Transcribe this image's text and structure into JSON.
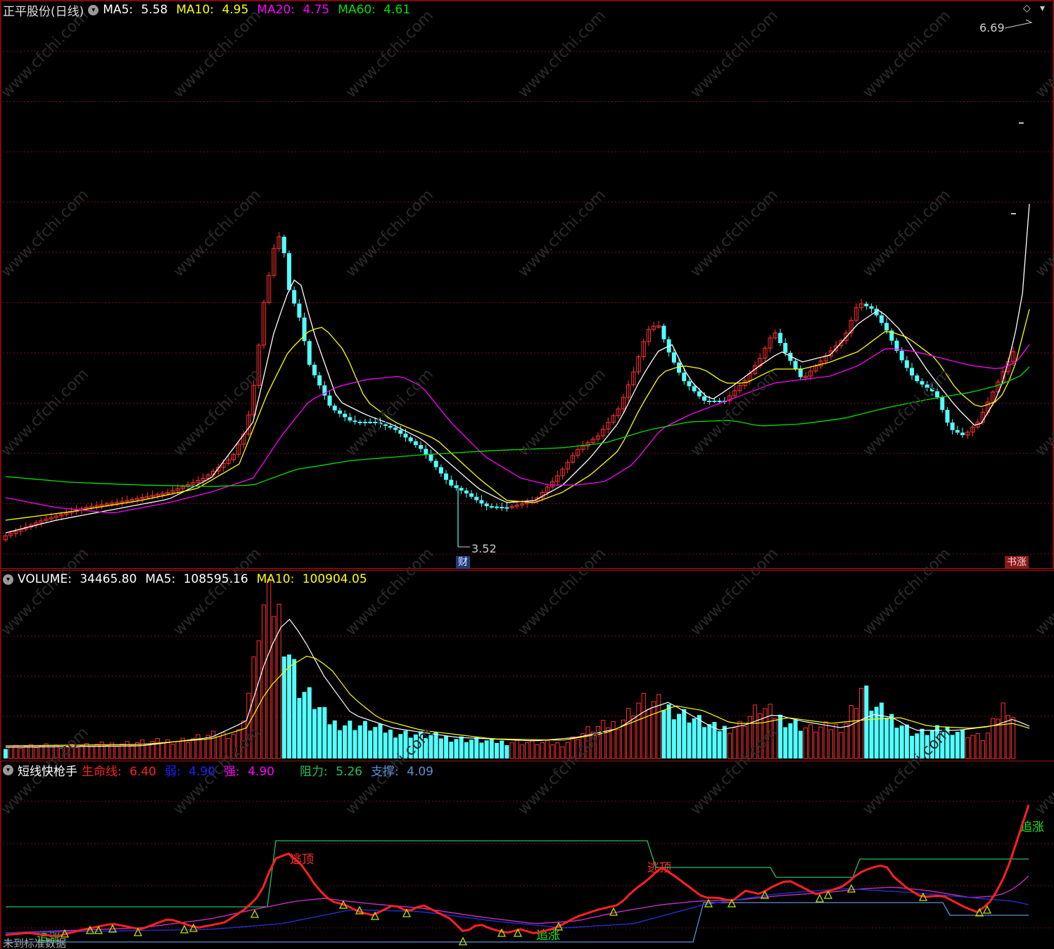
{
  "main": {
    "stock_title": "正平股份(日线)",
    "ma5_label": "MA5:",
    "ma5_value": "5.58",
    "ma10_label": "MA10:",
    "ma10_value": "4.95",
    "ma20_label": "MA20:",
    "ma20_value": "4.75",
    "ma60_label": "MA60:",
    "ma60_value": "4.61",
    "high_marker": "6.69",
    "low_marker": "3.52",
    "finance_badge": "财",
    "event_badge": "书涨",
    "corner_icon": "◇"
  },
  "volume": {
    "label": "VOLUME:",
    "value": "34465.80",
    "ma5_label": "MA5:",
    "ma5_value": "108595.16",
    "ma10_label": "MA10:",
    "ma10_value": "100904.05"
  },
  "indicator": {
    "name": "短线快枪手",
    "lifeline_label": "生命线:",
    "lifeline_value": "6.40",
    "weak_label": "弱:",
    "weak_value": "4.90",
    "strong_label": "强:",
    "strong_value": "4.90",
    "resist_label": "阻力:",
    "resist_value": "5.26",
    "support_label": "支撑:",
    "support_value": "4.09",
    "annotations": [
      "逃顶",
      "逃顶",
      "追涨",
      "追涨",
      "追涨"
    ],
    "footer_text": "未到标准数据"
  },
  "watermark": "www.cfchi.com",
  "colors": {
    "up": "#ff3232",
    "down": "#54ffff",
    "ma5": "#ffffff",
    "ma10": "#ffff00",
    "ma20": "#ff00ff",
    "ma60": "#00e000",
    "grid": "#7a1010",
    "lifeline": "#ff2020",
    "resist": "#20c060",
    "support": "#5a8fd0"
  }
}
